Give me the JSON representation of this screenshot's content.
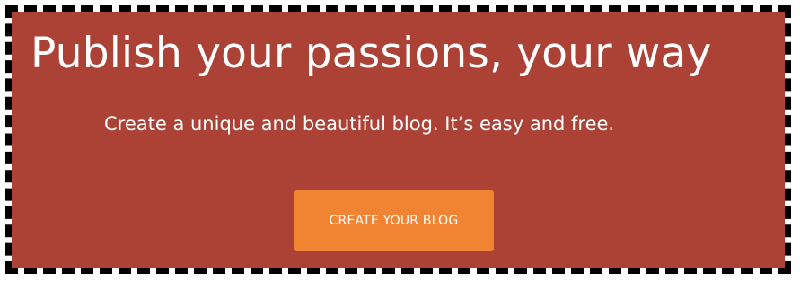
{
  "hero": {
    "headline": "Publish your passions, your way",
    "subtitle": "Create a unique and beautiful blog. It’s easy and free.",
    "cta_label": "CREATE YOUR BLOG"
  },
  "colors": {
    "hero_background": "#ac4236",
    "cta_background": "#f08432",
    "text": "#ffffff",
    "frame_border": "#000000"
  }
}
